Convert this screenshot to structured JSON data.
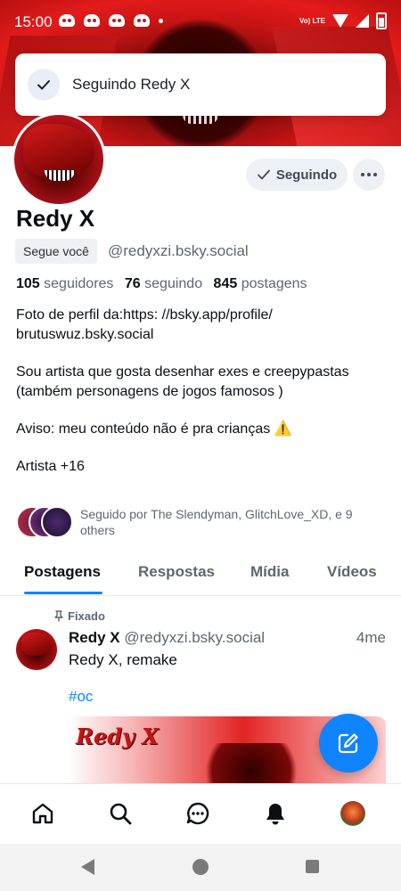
{
  "status_bar": {
    "time": "15:00",
    "network_label": "Vo) LTE"
  },
  "toast": {
    "message": "Seguindo Redy X"
  },
  "profile": {
    "follow_button_label": "Seguindo",
    "display_name": "Redy X",
    "follows_you_badge": "Segue você",
    "handle": "@redyxzi.bsky.social",
    "stats": {
      "followers_count": "105",
      "followers_label": "seguidores",
      "following_count": "76",
      "following_label": "seguindo",
      "posts_count": "845",
      "posts_label": "postagens"
    },
    "bio": {
      "line1": "Foto de perfil da:https: //bsky.app/profile/",
      "line2": "brutuswuz.bsky.social",
      "line3": "Sou artista que gosta desenhar exes e creepypastas (também personagens de jogos famosos )",
      "line4": "Aviso: meu conteúdo não é pra crianças ⚠️",
      "line5": "Artista +16"
    },
    "followed_by_text": "Seguido por The Slendyman, GlitchLove_XD, e 9 others"
  },
  "tabs": [
    {
      "label": "Postagens",
      "active": true
    },
    {
      "label": "Respostas",
      "active": false
    },
    {
      "label": "Mídia",
      "active": false
    },
    {
      "label": "Vídeos",
      "active": false
    }
  ],
  "post": {
    "pinned_label": "Fixado",
    "author": "Redy X",
    "handle": "@redyxzi.bsky.social",
    "time": "4me",
    "text": "Redy X, remake",
    "hashtag": "#oc",
    "image_title": "Redy X"
  },
  "bottom_nav": {
    "items": [
      "home-icon",
      "search-icon",
      "chat-icon",
      "bell-icon",
      "profile-avatar"
    ]
  },
  "colors": {
    "accent": "#1083fe",
    "banner_red": "#e31b1b",
    "muted_text": "#5c6772"
  }
}
